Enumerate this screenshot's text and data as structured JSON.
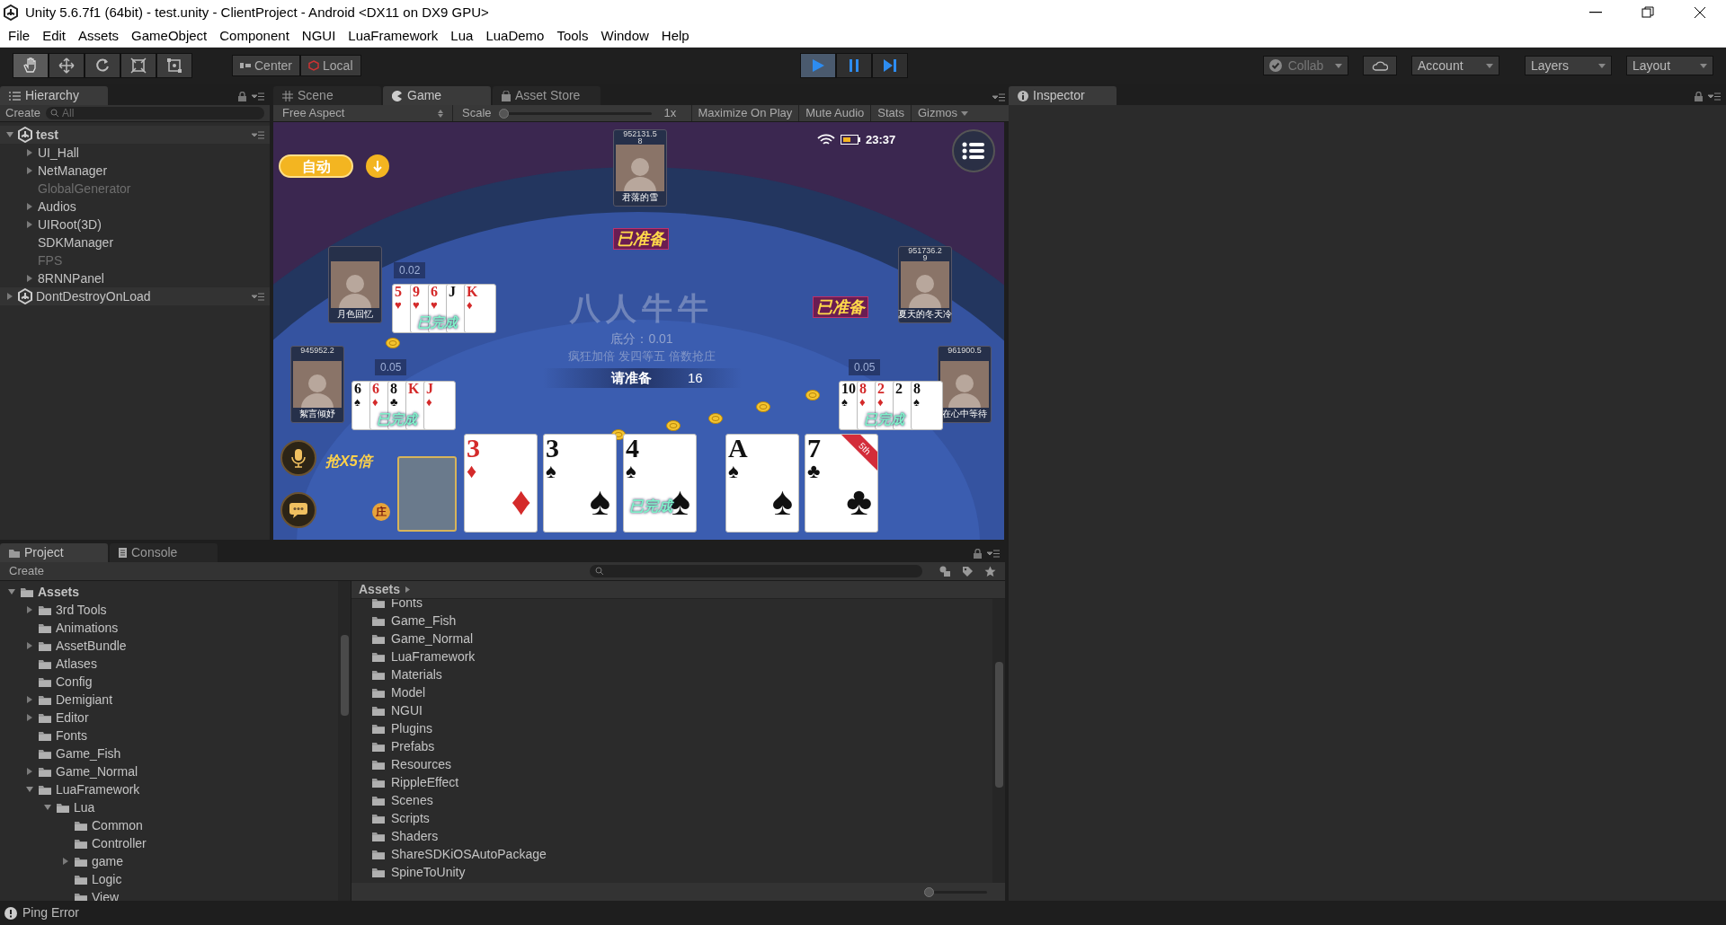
{
  "window": {
    "title": "Unity 5.6.7f1 (64bit) - test.unity - ClientProject - Android <DX11 on DX9 GPU>"
  },
  "menu": [
    "File",
    "Edit",
    "Assets",
    "GameObject",
    "Component",
    "NGUI",
    "LuaFramework",
    "Lua",
    "LuaDemo",
    "Tools",
    "Window",
    "Help"
  ],
  "toolbar": {
    "tools": [
      {
        "kind": "hand",
        "selected": true
      },
      {
        "kind": "move",
        "selected": false
      },
      {
        "kind": "rotate",
        "selected": false
      },
      {
        "kind": "scale",
        "selected": false
      },
      {
        "kind": "rect",
        "selected": false
      }
    ],
    "pivot": [
      {
        "kind": "pivot",
        "label": "Center"
      },
      {
        "kind": "space",
        "label": "Local"
      }
    ],
    "play": {
      "playing": true,
      "paused": false
    },
    "collab": "Collab",
    "account": "Account",
    "layers": "Layers",
    "layout": "Layout"
  },
  "hierarchy": {
    "tab": "Hierarchy",
    "create": "Create",
    "placeholder": "All",
    "items": [
      {
        "label": "test",
        "kind": "scene",
        "expanded": true,
        "active": true,
        "children": [
          {
            "label": "UI_Hall",
            "expanded": false,
            "active": true
          },
          {
            "label": "NetManager",
            "expanded": false,
            "active": true
          },
          {
            "label": "GlobalGenerator",
            "active": false
          },
          {
            "label": "Audios",
            "expanded": false,
            "active": true
          },
          {
            "label": "UIRoot(3D)",
            "expanded": false,
            "active": true
          },
          {
            "label": "SDKManager",
            "active": true
          },
          {
            "label": "FPS",
            "active": false
          },
          {
            "label": "8RNNPanel",
            "expanded": false,
            "active": true
          }
        ]
      },
      {
        "label": "DontDestroyOnLoad",
        "kind": "scene",
        "expanded": false,
        "active": true
      }
    ]
  },
  "view_tabs": [
    {
      "label": "Scene",
      "kind": "scene",
      "selected": false
    },
    {
      "label": "Game",
      "kind": "game",
      "selected": true
    },
    {
      "label": "Asset Store",
      "kind": "store",
      "selected": false
    }
  ],
  "game_toolbar": {
    "aspect": "Free Aspect",
    "scale_label": "Scale",
    "scale": {
      "level": 0
    },
    "scale_value": "1x",
    "buttons": [
      "Maximize On Play",
      "Mute Audio",
      "Stats",
      "Gizmos"
    ]
  },
  "game": {
    "auto_button": "自动",
    "clock": "23:37",
    "title": "八人牛牛",
    "base_score": "底分：0.01",
    "rules": "疯狂加倍 发四等五 倍数抢庄",
    "prompt": "请准备",
    "countdown": "16",
    "grab": "抢X5倍",
    "banker": "庄",
    "players": [
      {
        "score": "952131.5\n8",
        "name": "君落的雪"
      },
      {
        "name": "月色回忆"
      },
      {
        "score": "951736.2\n9",
        "name": "夏天的冬天冷"
      },
      {
        "score": "945952.2",
        "name": "絮言倾妤"
      },
      {
        "score": "961900.5",
        "name": "在心中等待"
      }
    ],
    "ready_labels": [
      "已准备",
      "已准备"
    ],
    "hands": [
      {
        "bet": "0.02",
        "status": "已完成",
        "cards": [
          {
            "rank": "5",
            "suit": "♥",
            "red": true
          },
          {
            "rank": "9",
            "suit": "♥",
            "red": true
          },
          {
            "rank": "6",
            "suit": "♥",
            "red": true
          },
          {
            "rank": "J",
            "red": false
          },
          {
            "rank": "K",
            "suit": "♦",
            "red": true
          }
        ]
      },
      {
        "bet": "0.05",
        "status": "已完成",
        "cards": [
          {
            "rank": "6",
            "suit": "♠",
            "red": false
          },
          {
            "rank": "6",
            "suit": "♦",
            "red": true
          },
          {
            "rank": "8",
            "suit": "♣",
            "red": false
          },
          {
            "rank": "K",
            "red": true
          },
          {
            "rank": "J",
            "suit": "♦",
            "red": true
          }
        ]
      },
      {
        "bet": "0.05",
        "status": "已完成",
        "cards": [
          {
            "rank": "10",
            "suit": "♠",
            "red": false
          },
          {
            "rank": "8",
            "suit": "♦",
            "red": true
          },
          {
            "rank": "2",
            "suit": "♦",
            "red": true
          },
          {
            "rank": "2",
            "red": false
          },
          {
            "rank": "8",
            "suit": "♠",
            "red": false
          }
        ]
      }
    ],
    "my_cards": [
      {
        "rank": "3",
        "suit": "♦",
        "red": true
      },
      {
        "rank": "3",
        "suit": "♠",
        "red": false
      },
      {
        "rank": "4",
        "suit": "♠",
        "red": false,
        "status": "已完成"
      },
      {
        "rank": "A",
        "suit": "♠",
        "red": false
      },
      {
        "rank": "7",
        "suit": "♣",
        "red": false,
        "ribbon": "5th"
      }
    ]
  },
  "inspector": {
    "tab": "Inspector"
  },
  "project": {
    "tabs": [
      {
        "label": "Project",
        "kind": "project",
        "selected": true
      },
      {
        "label": "Console",
        "kind": "console",
        "selected": false
      }
    ],
    "create": "Create",
    "tree": [
      {
        "label": "Assets",
        "expanded": true,
        "children": [
          {
            "label": "3rd Tools",
            "expanded": false
          },
          {
            "label": "Animations"
          },
          {
            "label": "AssetBundle",
            "expanded": false
          },
          {
            "label": "Atlases"
          },
          {
            "label": "Config"
          },
          {
            "label": "Demigiant",
            "expanded": false
          },
          {
            "label": "Editor",
            "expanded": false
          },
          {
            "label": "Fonts"
          },
          {
            "label": "Game_Fish"
          },
          {
            "label": "Game_Normal",
            "expanded": false
          },
          {
            "label": "LuaFramework",
            "expanded": true,
            "children": [
              {
                "label": "Lua",
                "expanded": true,
                "children": [
                  {
                    "label": "Common"
                  },
                  {
                    "label": "Controller"
                  },
                  {
                    "label": "game",
                    "expanded": false
                  },
                  {
                    "label": "Logic"
                  },
                  {
                    "label": "View"
                  }
                ]
              }
            ]
          }
        ]
      }
    ],
    "breadcrumb": "Assets",
    "folders": [
      "Fonts",
      "Game_Fish",
      "Game_Normal",
      "LuaFramework",
      "Materials",
      "Model",
      "NGUI",
      "Plugins",
      "Prefabs",
      "Resources",
      "RippleEffect",
      "Scenes",
      "Scripts",
      "Shaders",
      "ShareSDKiOSAutoPackage",
      "SpineToUnity"
    ],
    "thumb_size": {
      "level": 0
    }
  },
  "status_bar": {
    "message": "Ping Error"
  }
}
